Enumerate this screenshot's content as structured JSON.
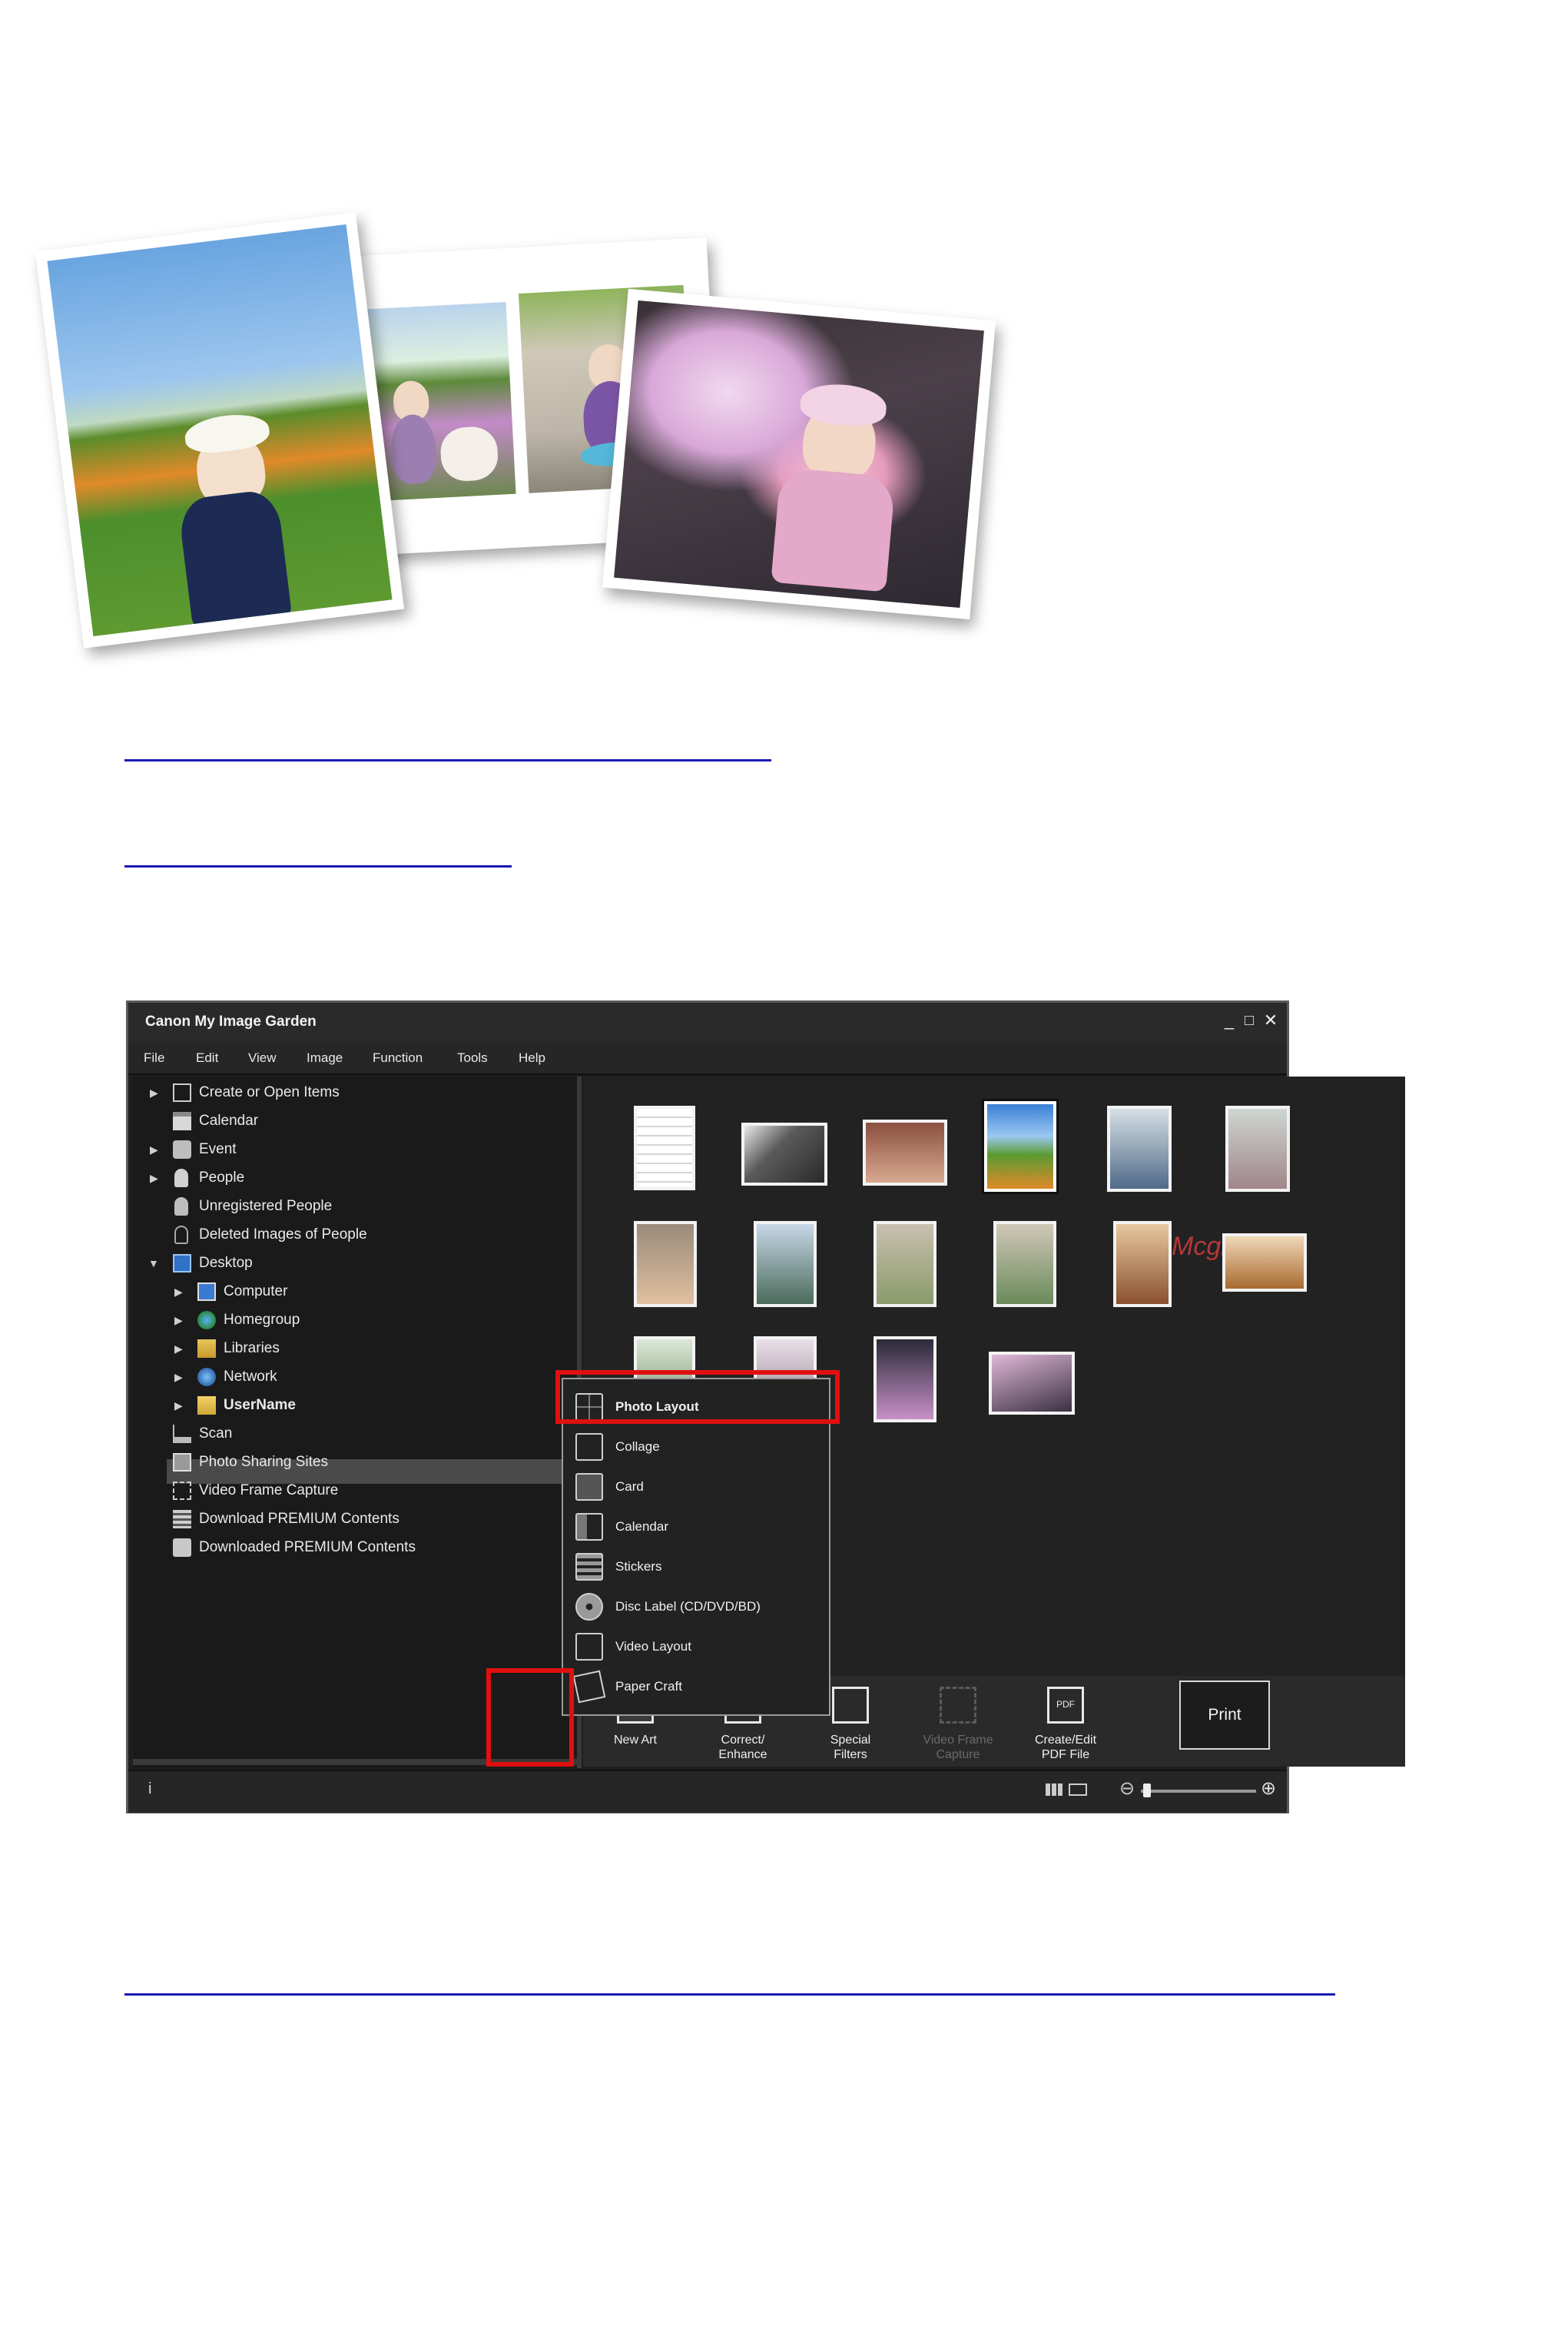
{
  "app": {
    "title": "Canon My Image Garden",
    "window_controls": [
      "_",
      "□",
      "✕"
    ]
  },
  "menu": [
    "File",
    "Edit",
    "View",
    "Image",
    "Function",
    "Tools",
    "Help"
  ],
  "sidebar": {
    "items": [
      {
        "label": "Create or Open Items",
        "icon": "create-icon",
        "arrow": "▶"
      },
      {
        "label": "Calendar",
        "icon": "calendar-icon",
        "arrow": ""
      },
      {
        "label": "Event",
        "icon": "event-icon",
        "arrow": "▶"
      },
      {
        "label": "People",
        "icon": "people-icon",
        "arrow": "▶"
      },
      {
        "label": "Unregistered People",
        "icon": "unregistered-people-icon",
        "arrow": ""
      },
      {
        "label": "Deleted Images of People",
        "icon": "deleted-people-icon",
        "arrow": ""
      },
      {
        "label": "Desktop",
        "icon": "desktop-icon",
        "arrow": "▼"
      },
      {
        "label": "Computer",
        "icon": "computer-icon",
        "arrow": "▶"
      },
      {
        "label": "Homegroup",
        "icon": "homegroup-icon",
        "arrow": "▶"
      },
      {
        "label": "Libraries",
        "icon": "libraries-icon",
        "arrow": "▶"
      },
      {
        "label": "Network",
        "icon": "network-icon",
        "arrow": "▶"
      },
      {
        "label": "UserName",
        "icon": "user-folder-icon",
        "arrow": "▶"
      },
      {
        "label": "Scan",
        "icon": "scan-icon",
        "arrow": ""
      },
      {
        "label": "Photo Sharing Sites",
        "icon": "photo-sharing-icon",
        "arrow": ""
      },
      {
        "label": "Video Frame Capture",
        "icon": "video-capture-icon",
        "arrow": ""
      },
      {
        "label": "Download PREMIUM Contents",
        "icon": "download-icon",
        "arrow": ""
      },
      {
        "label": "Downloaded PREMIUM Contents",
        "icon": "downloaded-folder-icon",
        "arrow": ""
      }
    ]
  },
  "watermark": "Mcgrp.Ru",
  "popup_menu": {
    "items": [
      "Photo Layout",
      "Collage",
      "Card",
      "Calendar",
      "Stickers",
      "Disc Label (CD/DVD/BD)",
      "Video Layout",
      "Paper Craft"
    ]
  },
  "toolbar": {
    "new_art": "New Art",
    "correct_enhance": [
      "Correct/",
      "Enhance"
    ],
    "special_filters": [
      "Special",
      "Filters"
    ],
    "video_frame_capture": [
      "Video Frame",
      "Capture"
    ],
    "create_edit_pdf": [
      "Create/Edit",
      "PDF File"
    ],
    "print": "Print",
    "pdf_badge": "PDF"
  },
  "status": {
    "info_icon": "i",
    "zoom_minus": "⊖",
    "zoom_plus": "⊕",
    "zoom_level": 0.02
  },
  "colors": {
    "highlight_red": "#e01010",
    "link_blue": "#1a1ab0",
    "window_bg": "#1e1e1e"
  }
}
